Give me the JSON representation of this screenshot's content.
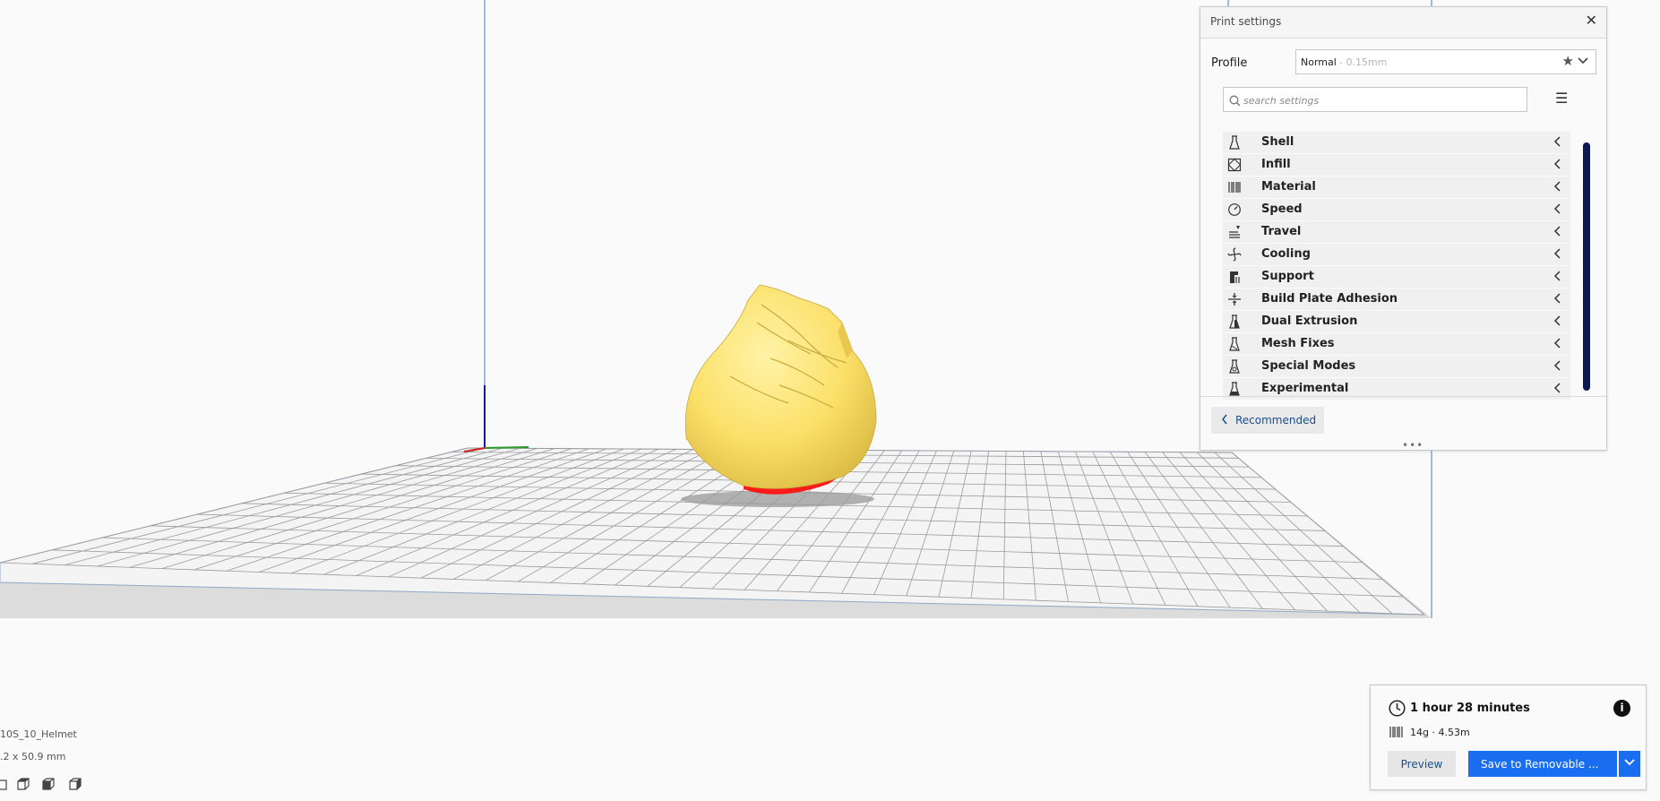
{
  "print_settings": {
    "title": "Print settings",
    "close_icon": "close-icon",
    "profile": {
      "label": "Profile",
      "name": "Normal",
      "layer_height": "- 0.15mm"
    },
    "search": {
      "placeholder": "search settings",
      "value": ""
    },
    "categories": [
      {
        "label": "Shell",
        "icon": "shell-icon"
      },
      {
        "label": "Infill",
        "icon": "infill-icon"
      },
      {
        "label": "Material",
        "icon": "material-icon"
      },
      {
        "label": "Speed",
        "icon": "speed-icon"
      },
      {
        "label": "Travel",
        "icon": "travel-icon"
      },
      {
        "label": "Cooling",
        "icon": "cooling-icon"
      },
      {
        "label": "Support",
        "icon": "support-icon"
      },
      {
        "label": "Build Plate Adhesion",
        "icon": "build-plate-adhesion-icon"
      },
      {
        "label": "Dual Extrusion",
        "icon": "dual-extrusion-icon"
      },
      {
        "label": "Mesh Fixes",
        "icon": "mesh-fixes-icon"
      },
      {
        "label": "Special Modes",
        "icon": "special-modes-icon"
      },
      {
        "label": "Experimental",
        "icon": "experimental-icon"
      }
    ],
    "recommended_label": "Recommended",
    "resize_handle": "•••"
  },
  "print_summary": {
    "time": "1 hour 28 minutes",
    "material": "14g · 4.53m",
    "preview_label": "Preview",
    "save_label": "Save to Removable ..."
  },
  "object_info": {
    "name": "10S_10_Helmet",
    "dimensions": ".2 x 50.9 mm"
  },
  "colors": {
    "accent": "#196ef0",
    "scroll_thumb": "#0a1a4f",
    "model": "#fde87a",
    "overhang": "#ff0000"
  }
}
